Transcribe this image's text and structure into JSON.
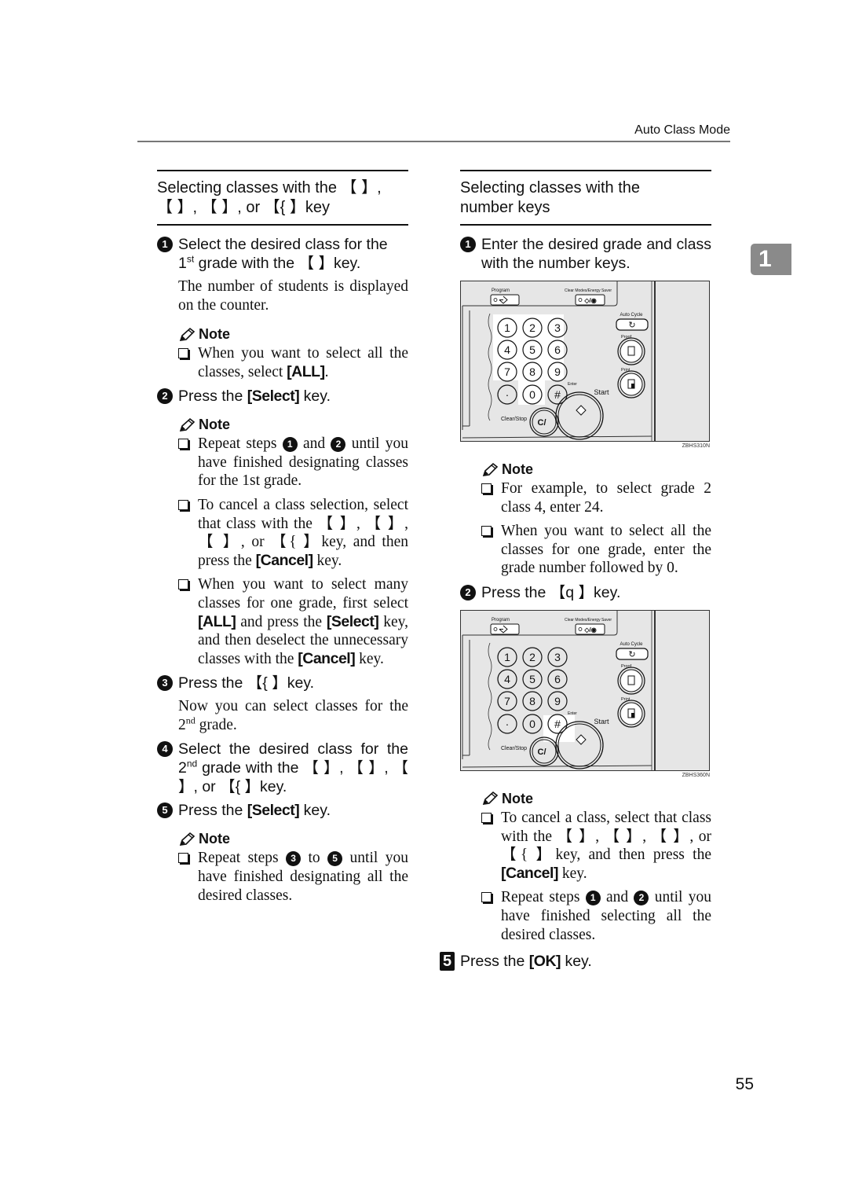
{
  "running_head": "Auto Class Mode",
  "chapter_tab": "1",
  "page_number": "55",
  "left": {
    "section_title_line1": "Selecting classes with the 【   】,",
    "section_title_line2": "【   】, 【   】, or 【{  】key",
    "step1": {
      "num": "1",
      "text_a": "Select the desired class for the",
      "text_b_pre": "1",
      "text_b_sup": "st",
      "text_b_post": " grade with the 【   】key."
    },
    "step1_body": "The number of students is displayed on the counter.",
    "note1": {
      "label": "Note",
      "items": [
        {
          "pre": "When you want to select all the classes, select ",
          "key": "[ALL]",
          "post": "."
        }
      ]
    },
    "step2": {
      "num": "2",
      "pre": "Press the ",
      "key": "[Select]",
      "post": " key."
    },
    "note2": {
      "label": "Note",
      "item1": {
        "pre": "Repeat steps ",
        "n1": "1",
        "mid": " and ",
        "n2": "2",
        "post": " until you have finished designating classes for the 1st grade."
      },
      "item2": {
        "pre": "To cancel a class selection, select that class with the 【   】, 【   】, 【   】, or 【{  】key, and then press the ",
        "key": "[Cancel]",
        "post": " key."
      },
      "item3": {
        "pre": "When you want to select many classes for one grade, first select ",
        "key1": "[ALL]",
        "mid1": " and press the ",
        "key2": "[Select]",
        "mid2": " key, and then deselect the unnecessary classes with the ",
        "key3": "[Cancel]",
        "post": " key."
      }
    },
    "step3": {
      "num": "3",
      "text": "Press the 【{  】key."
    },
    "step3_body": {
      "pre": "Now you can select classes for the 2",
      "sup": "nd",
      "post": " grade."
    },
    "step4": {
      "num": "4",
      "pre": "Select the desired class for the 2",
      "sup": "nd",
      "post": " grade with the 【   】, 【   】, 【   】, or 【{  】key."
    },
    "step5": {
      "num": "5",
      "pre": "Press the ",
      "key": "[Select]",
      "post": " key."
    },
    "note3": {
      "label": "Note",
      "item1": {
        "pre": "Repeat steps ",
        "n1": "3",
        "mid": " to ",
        "n2": "5",
        "post": " until you have finished designating all the desired classes."
      }
    }
  },
  "right": {
    "section_title": "Selecting classes with the number keys",
    "step1": {
      "num": "1",
      "text": "Enter the desired grade and class with the number keys."
    },
    "figure1": {
      "id": "ZBHS310N",
      "highlight": "number-keys"
    },
    "note1": {
      "label": "Note",
      "item1": "For example, to select grade 2 class 4, enter 24.",
      "item2": "When you want to select all the classes for one grade, enter the grade number followed by 0."
    },
    "step2": {
      "num": "2",
      "text": "Press the 【q  】key."
    },
    "figure2": {
      "id": "ZBHS360N",
      "highlight": "enter-key"
    },
    "note2": {
      "label": "Note",
      "item1": {
        "pre": "To cancel a class, select that class with the 【   】, 【   】, 【   】, or 【{  】key, and then press the ",
        "key": "[Cancel]",
        "post": " key."
      },
      "item2": {
        "pre": "Repeat steps ",
        "n1": "1",
        "mid": " and ",
        "n2": "2",
        "post": " until you have finished selecting all the desired classes."
      }
    },
    "step5": {
      "num": "5",
      "pre": "Press the ",
      "key": "[OK]",
      "post": " key."
    }
  },
  "panel": {
    "program": "Program",
    "clear_modes": "Clear Modes/Energy Saver",
    "auto_cycle": "Auto Cycle",
    "proof": "Proof",
    "print": "Print",
    "start": "Start",
    "enter": "Enter",
    "clear_stop": "Clear/Stop",
    "keys": [
      "1",
      "2",
      "3",
      "4",
      "5",
      "6",
      "7",
      "8",
      "9",
      "·",
      "0",
      "#"
    ]
  },
  "colors": {
    "panel_bg": "#e6e6e6",
    "tab_bg": "#8a8a8a",
    "highlight": "#ffffff"
  }
}
